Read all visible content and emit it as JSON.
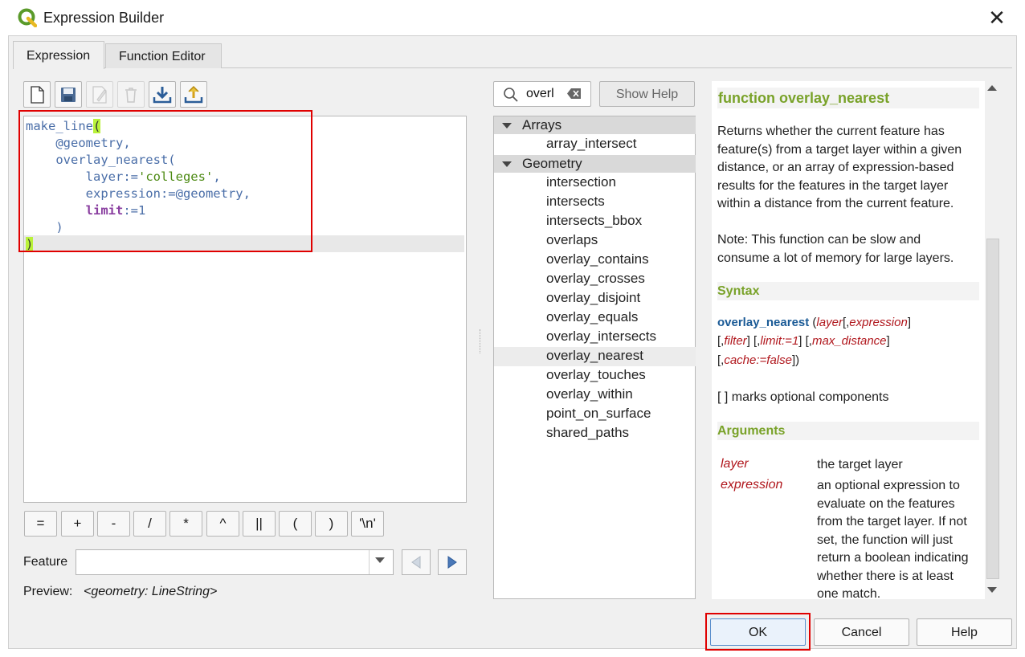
{
  "window": {
    "title": "Expression Builder",
    "close_icon": "close-icon"
  },
  "tabs": [
    {
      "label": "Expression",
      "active": true
    },
    {
      "label": "Function Editor",
      "active": false
    }
  ],
  "toolbar": {
    "buttons": [
      {
        "icon": "new-file-icon",
        "enabled": true
      },
      {
        "icon": "save-icon",
        "enabled": true
      },
      {
        "icon": "edit-icon",
        "enabled": false
      },
      {
        "icon": "delete-icon",
        "enabled": false
      },
      {
        "icon": "import-icon",
        "enabled": true
      },
      {
        "icon": "export-icon",
        "enabled": true
      }
    ]
  },
  "editor": {
    "lines": {
      "l1_func": "make_line",
      "l1_paren": "(",
      "l2": "    @geometry,",
      "l3": "    overlay_nearest(",
      "l4_key": "        layer:=",
      "l4_str": "'colleges'",
      "l4_comma": ",",
      "l5": "        expression:=@geometry,",
      "l6_pad": "        ",
      "l6_kw": "limit",
      "l6_rest": ":=1",
      "l7": "    )",
      "l8": ")"
    }
  },
  "operators": [
    "=",
    "+",
    "-",
    "/",
    "*",
    "^",
    "||",
    "(",
    ")",
    "'\\n'"
  ],
  "feature": {
    "label": "Feature",
    "value": ""
  },
  "preview": {
    "label": "Preview:",
    "value": "<geometry: LineString>"
  },
  "search": {
    "value": "overl",
    "show_help_label": "Show Help"
  },
  "tree": {
    "groups": [
      {
        "label": "Arrays",
        "items": [
          "array_intersect"
        ]
      },
      {
        "label": "Geometry",
        "items": [
          "intersection",
          "intersects",
          "intersects_bbox",
          "overlaps",
          "overlay_contains",
          "overlay_crosses",
          "overlay_disjoint",
          "overlay_equals",
          "overlay_intersects",
          "overlay_nearest",
          "overlay_touches",
          "overlay_within",
          "point_on_surface",
          "shared_paths"
        ]
      }
    ],
    "selected": "overlay_nearest"
  },
  "help": {
    "title": "function overlay_nearest",
    "description": "Returns whether the current feature has feature(s) from a target layer within a given distance, or an array of expression-based results for the features in the target layer within a distance from the current feature.",
    "note": "Note: This function can be slow and consume a lot of memory for large layers.",
    "syntax_heading": "Syntax",
    "sig": {
      "fn": "overlay_nearest",
      "a1": "layer",
      "a2": "expression",
      "a3": "filter",
      "a4": "limit:=1",
      "a5": "max_distance",
      "a6": "cache:=false"
    },
    "optional_note": "[ ] marks optional components",
    "arguments_heading": "Arguments",
    "arguments": [
      {
        "name": "layer",
        "desc": "the target layer"
      },
      {
        "name": "expression",
        "desc": "an optional expression to evaluate on the features from the target layer. If not set, the function will just return a boolean indicating whether there is at least one match."
      }
    ]
  },
  "buttons": {
    "ok": "OK",
    "cancel": "Cancel",
    "help": "Help"
  },
  "colors": {
    "highlight": "#e00000",
    "help_heading": "#79a229",
    "arg_name": "#b0161c"
  }
}
